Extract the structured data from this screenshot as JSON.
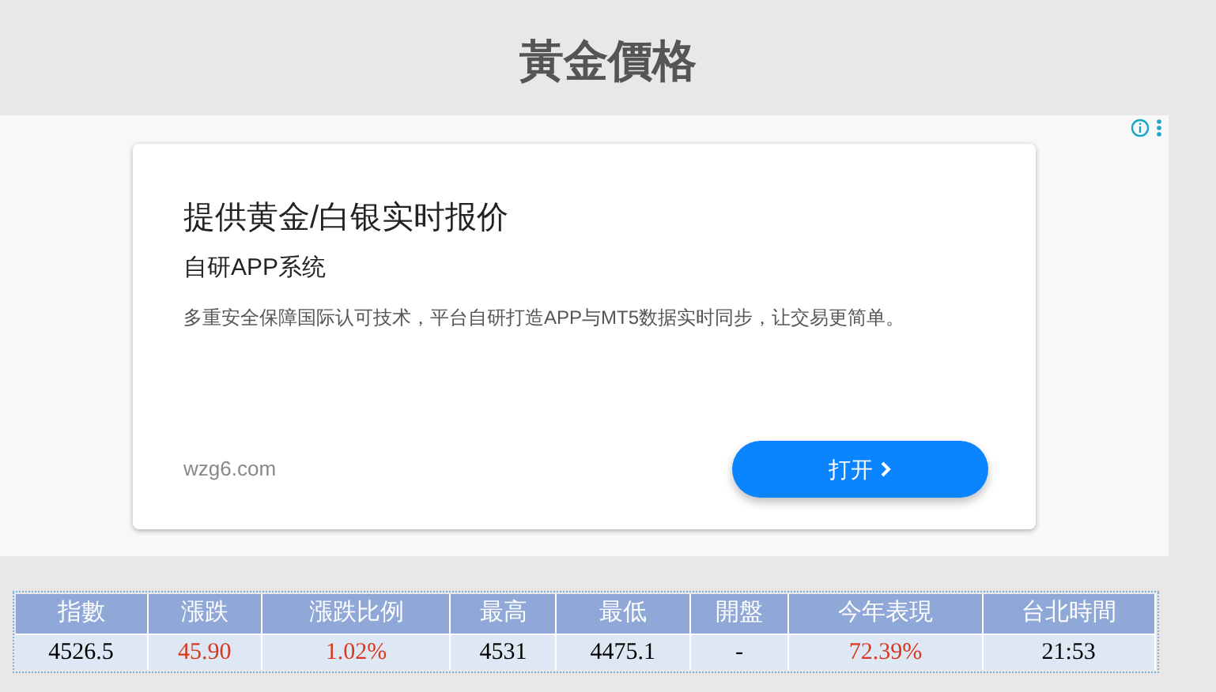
{
  "title": "黃金價格",
  "ad": {
    "headline": "提供黄金/白银实时报价",
    "subtitle": "自研APP系统",
    "description": "多重安全保障国际认可技术，平台自研打造APP与MT5数据实时同步，让交易更简单。",
    "domain": "wzg6.com",
    "button": "打开"
  },
  "table": {
    "columns": [
      "指數",
      "漲跌",
      "漲跌比例",
      "最高",
      "最低",
      "開盤",
      "今年表現",
      "台北時間"
    ],
    "rows": [
      {
        "cells": [
          {
            "text": "4526.5",
            "kind": "plain"
          },
          {
            "text": "45.90",
            "kind": "up"
          },
          {
            "text": "1.02%",
            "kind": "up"
          },
          {
            "text": "4531",
            "kind": "plain"
          },
          {
            "text": "4475.1",
            "kind": "plain"
          },
          {
            "text": "-",
            "kind": "plain"
          },
          {
            "text": "72.39%",
            "kind": "up"
          },
          {
            "text": "21:53",
            "kind": "plain"
          }
        ]
      }
    ]
  }
}
